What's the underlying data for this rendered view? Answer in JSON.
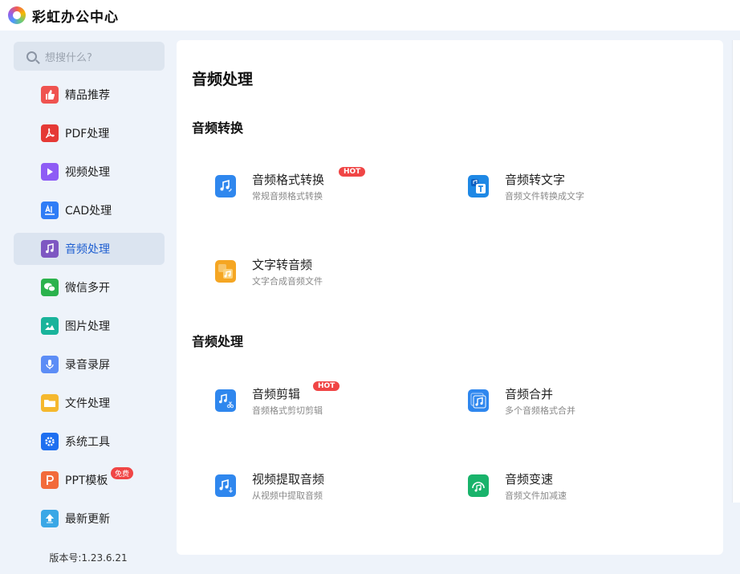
{
  "app": {
    "title": "彩虹办公中心"
  },
  "search": {
    "placeholder": "想搜什么?"
  },
  "sidebar": {
    "items": [
      {
        "label": "精品推荐",
        "icon": "thumbs-up-icon",
        "color": "#ef5350"
      },
      {
        "label": "PDF处理",
        "icon": "pdf-icon",
        "color": "#e53935"
      },
      {
        "label": "视频处理",
        "icon": "play-icon",
        "color": "#8e5cf5"
      },
      {
        "label": "CAD处理",
        "icon": "cad-icon",
        "color": "#2f7df6"
      },
      {
        "label": "音频处理",
        "icon": "music-note-icon",
        "color": "#7e57c2"
      },
      {
        "label": "微信多开",
        "icon": "wechat-icon",
        "color": "#2bb24c"
      },
      {
        "label": "图片处理",
        "icon": "image-icon",
        "color": "#19b39b"
      },
      {
        "label": "录音录屏",
        "icon": "microphone-icon",
        "color": "#5c8df6"
      },
      {
        "label": "文件处理",
        "icon": "folder-icon",
        "color": "#f5b82e"
      },
      {
        "label": "系统工具",
        "icon": "gear-icon",
        "color": "#1e6ff0"
      },
      {
        "label": "PPT模板",
        "icon": "ppt-icon",
        "color": "#f26b3a",
        "badge": "免费"
      },
      {
        "label": "最新更新",
        "icon": "upload-arrow-icon",
        "color": "#3aa7e6"
      }
    ],
    "active_index": 4,
    "version": "版本号:1.23.6.21"
  },
  "main": {
    "title": "音频处理",
    "sections": [
      {
        "title": "音频转换",
        "tools": [
          {
            "name": "音频格式转换",
            "desc": "常规音频格式转换",
            "hot": "HOT",
            "icon": "audio-convert-icon",
            "color": "#2f87ee"
          },
          {
            "name": "音频转文字",
            "desc": "音频文件转换成文字",
            "icon": "audio-to-text-icon",
            "color": "#1e88e5"
          },
          {
            "name": "文字转音频",
            "desc": "文字合成音频文件",
            "icon": "text-to-audio-icon",
            "color": "#f5a623"
          }
        ]
      },
      {
        "title": "音频处理",
        "tools": [
          {
            "name": "音频剪辑",
            "desc": "音频格式剪切剪辑",
            "hot": "HOT",
            "icon": "audio-cut-icon",
            "color": "#2f87ee"
          },
          {
            "name": "音频合并",
            "desc": "多个音频格式合并",
            "icon": "audio-merge-icon",
            "color": "#2f87ee"
          },
          {
            "name": "视频提取音频",
            "desc": "从视频中提取音频",
            "icon": "video-extract-audio-icon",
            "color": "#2f87ee"
          },
          {
            "name": "音频变速",
            "desc": "音频文件加减速",
            "icon": "audio-speed-icon",
            "color": "#19b36b"
          }
        ]
      }
    ]
  }
}
